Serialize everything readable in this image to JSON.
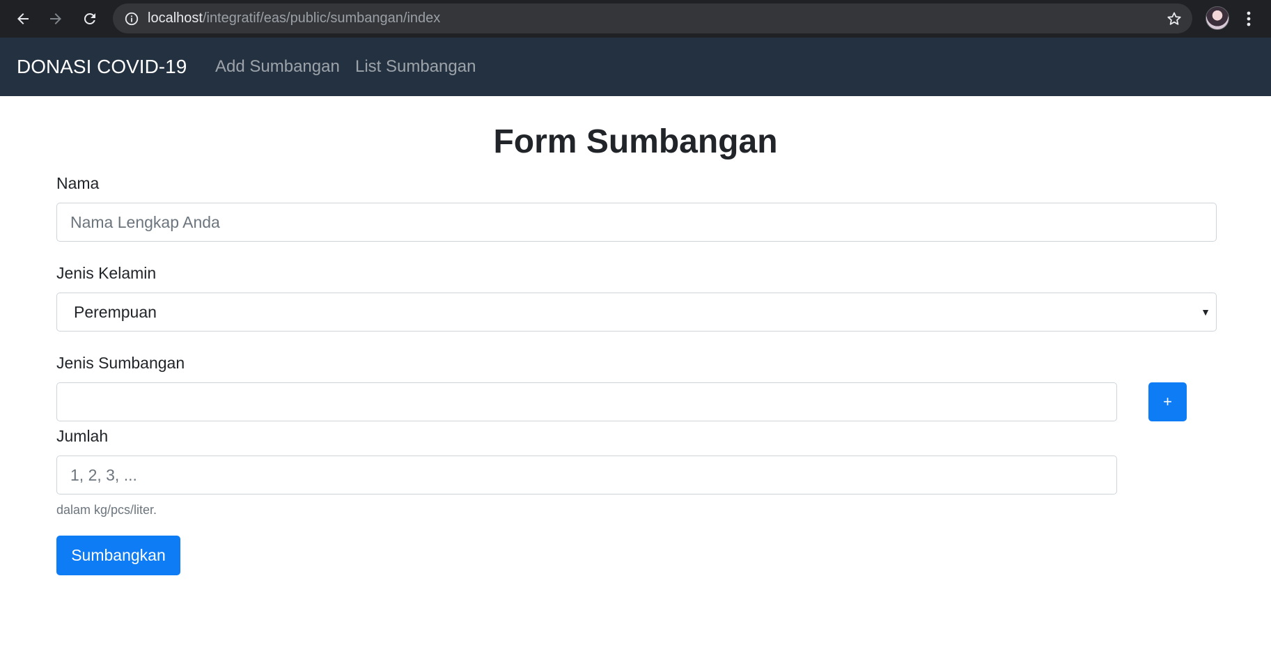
{
  "browser": {
    "url_host": "localhost",
    "url_path": "/integratif/eas/public/sumbangan/index"
  },
  "navbar": {
    "brand": "DONASI COVID-19",
    "links": [
      "Add Sumbangan",
      "List Sumbangan"
    ]
  },
  "form": {
    "title": "Form Sumbangan",
    "nama_label": "Nama",
    "nama_placeholder": "Nama Lengkap Anda",
    "nama_value": "",
    "kelamin_label": "Jenis Kelamin",
    "kelamin_selected": "Perempuan",
    "jenis_label": "Jenis Sumbangan",
    "jenis_value": "",
    "add_button_label": "+",
    "jumlah_label": "Jumlah",
    "jumlah_placeholder": "1, 2, 3, ...",
    "jumlah_value": "",
    "jumlah_help": "dalam kg/pcs/liter.",
    "submit_label": "Sumbangkan"
  },
  "colors": {
    "navbar_bg": "#243140",
    "primary": "#0d7cf5",
    "browser_bg": "#202124"
  }
}
